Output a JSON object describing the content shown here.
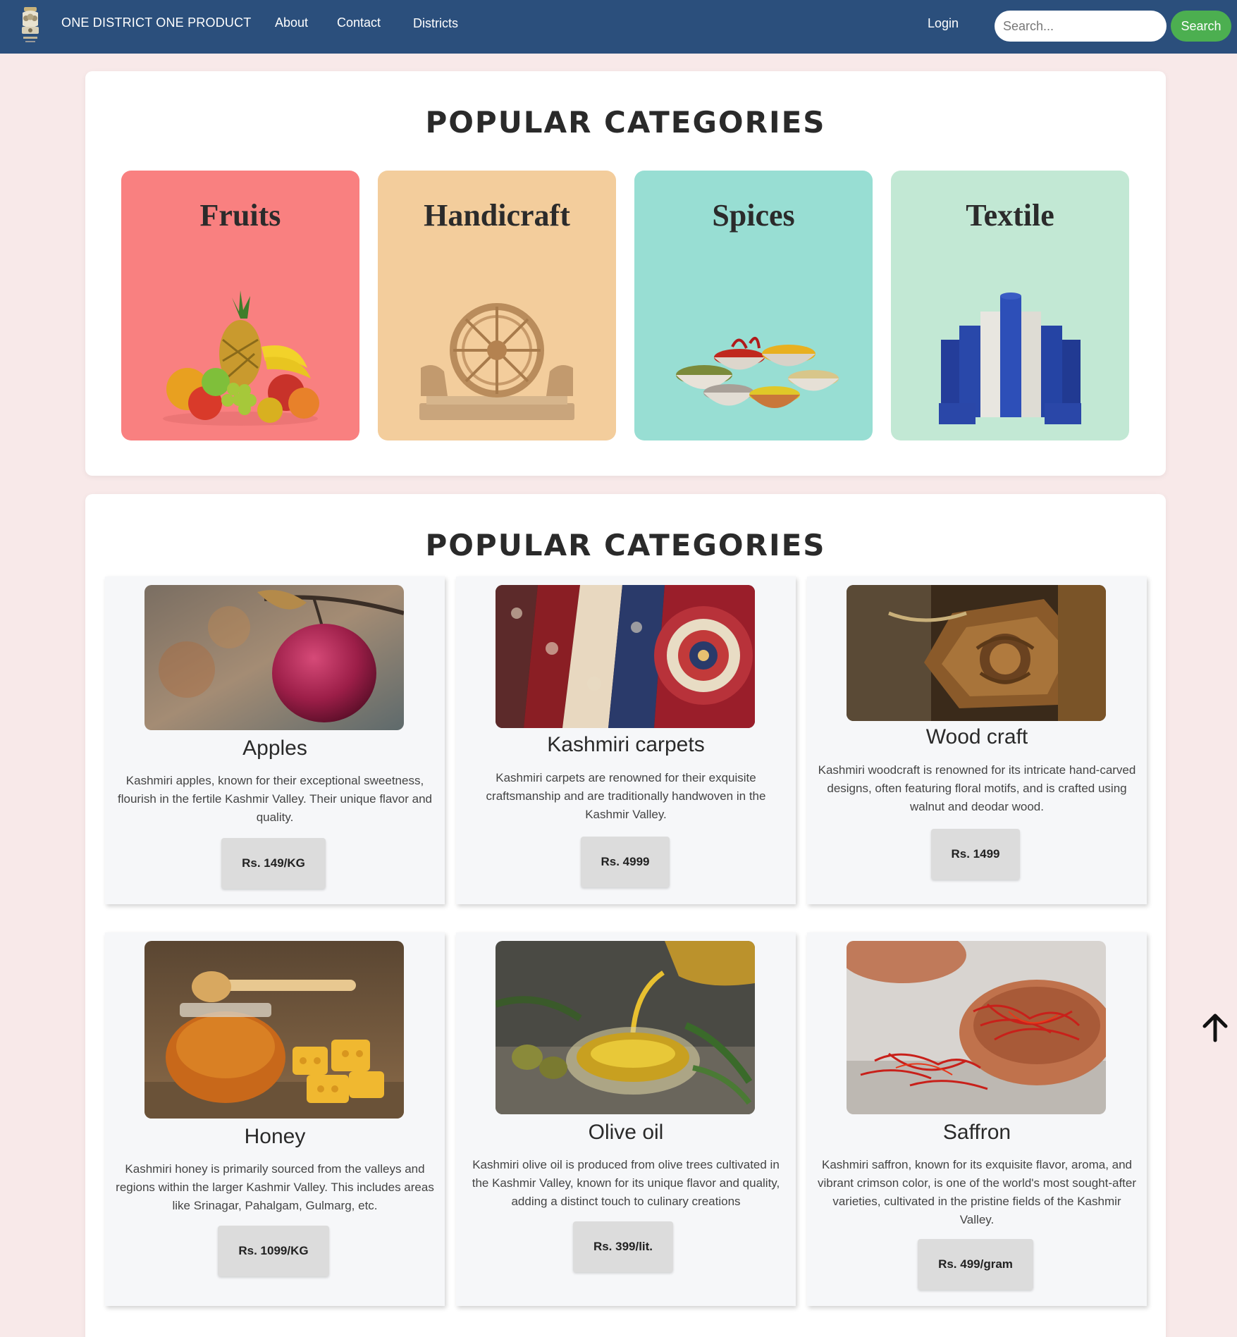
{
  "nav": {
    "brand": "ONE DISTRICT ONE PRODUCT",
    "links": [
      "About",
      "Contact",
      "Districts"
    ],
    "login": "Login",
    "search_placeholder": "Search...",
    "search_button": "Search"
  },
  "categories_section": {
    "title": "POPULAR CATEGORIES",
    "items": [
      {
        "label": "Fruits",
        "color": "#f98080",
        "icon": "fruits-basket-image"
      },
      {
        "label": "Handicraft",
        "color": "#f3cd9c",
        "icon": "wooden-wheel-image"
      },
      {
        "label": "Spices",
        "color": "#98ded3",
        "icon": "spice-bowls-image"
      },
      {
        "label": "Textile",
        "color": "#c2e8d4",
        "icon": "fabric-rolls-image"
      }
    ]
  },
  "products_section": {
    "title": "POPULAR CATEGORIES",
    "items": [
      {
        "name": "Apples",
        "description": "Kashmiri apples, known for their exceptional sweetness, flourish in the fertile Kashmir Valley. Their unique flavor and quality.",
        "price": "Rs. 149/KG"
      },
      {
        "name": "Kashmiri carpets",
        "description": "Kashmiri carpets are renowned for their exquisite craftsmanship and are traditionally handwoven in the Kashmir Valley.",
        "price": "Rs. 4999"
      },
      {
        "name": "Wood craft",
        "description": "Kashmiri woodcraft is renowned for its intricate hand-carved designs, often featuring floral motifs, and is crafted using walnut and deodar wood.",
        "price": "Rs. 1499"
      },
      {
        "name": "Honey",
        "description": "Kashmiri honey is primarily sourced from the valleys and regions within the larger Kashmir Valley. This includes areas like Srinagar, Pahalgam, Gulmarg, etc.",
        "price": "Rs. 1099/KG"
      },
      {
        "name": "Olive oil",
        "description": "Kashmiri olive oil is produced from olive trees cultivated in the Kashmir Valley, known for its unique flavor and quality, adding a distinct touch to culinary creations",
        "price": "Rs. 399/lit."
      },
      {
        "name": "Saffron",
        "description": "Kashmiri saffron, known for its exquisite flavor, aroma, and vibrant crimson color, is one of the world's most sought-after varieties, cultivated in the pristine fields of the Kashmir Valley.",
        "price": "Rs. 499/gram"
      }
    ]
  }
}
